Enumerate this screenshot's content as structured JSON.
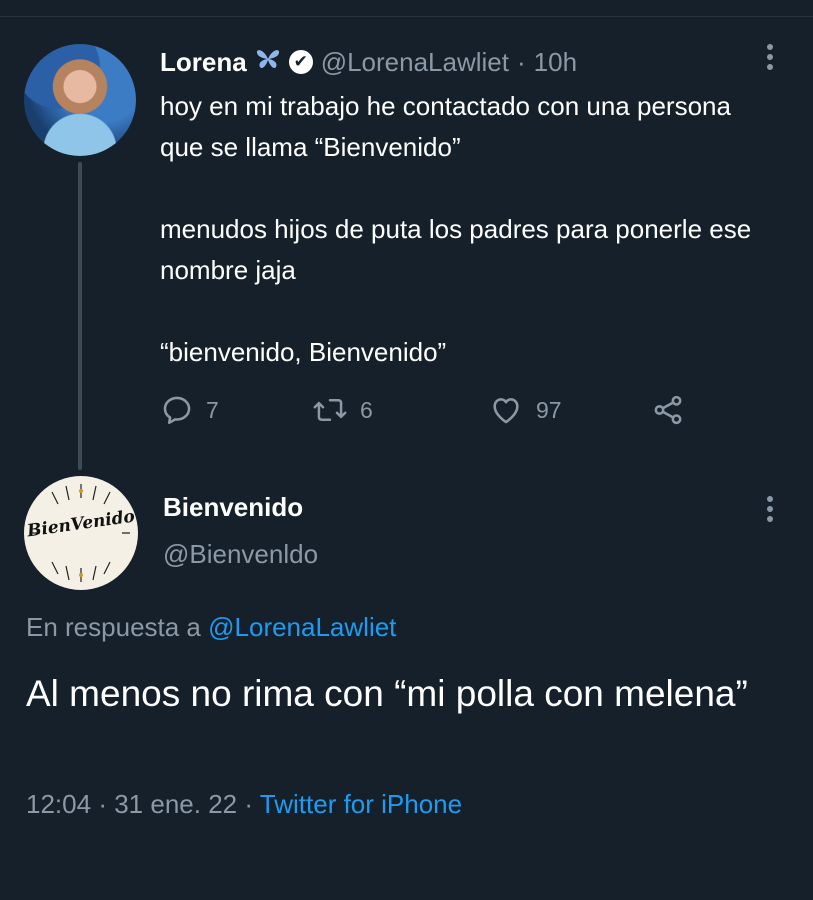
{
  "original_tweet": {
    "display_name": "Lorena",
    "name_emoji": "butterfly-icon",
    "verified_mark": "✔",
    "handle": "@LorenaLawliet",
    "separator": "·",
    "time": "10h",
    "paragraphs": [
      "hoy en mi trabajo he contactado con una persona que se llama “Bienvenido”",
      "menudos hijos de puta los padres para ponerle ese nombre jaja",
      "“bienvenido, Bienvenido”"
    ],
    "stats": {
      "replies": "7",
      "retweets": "6",
      "likes": "97"
    }
  },
  "reply_tweet": {
    "display_name": "Bienvenido",
    "handle": "@Bienvenldo",
    "avatar_logo_text": "BienVenido",
    "reply_prefix": "En respuesta a",
    "reply_to_handle": "@LorenaLawliet",
    "text": "Al menos no rima con “mi polla con melena”",
    "time": "12:04",
    "separator": "·",
    "date": "31 ene. 22",
    "source": "Twitter for iPhone"
  },
  "colors": {
    "background": "#15202b",
    "text": "#ffffff",
    "secondary_text": "#8b98a5",
    "link": "#1d9bf0"
  }
}
